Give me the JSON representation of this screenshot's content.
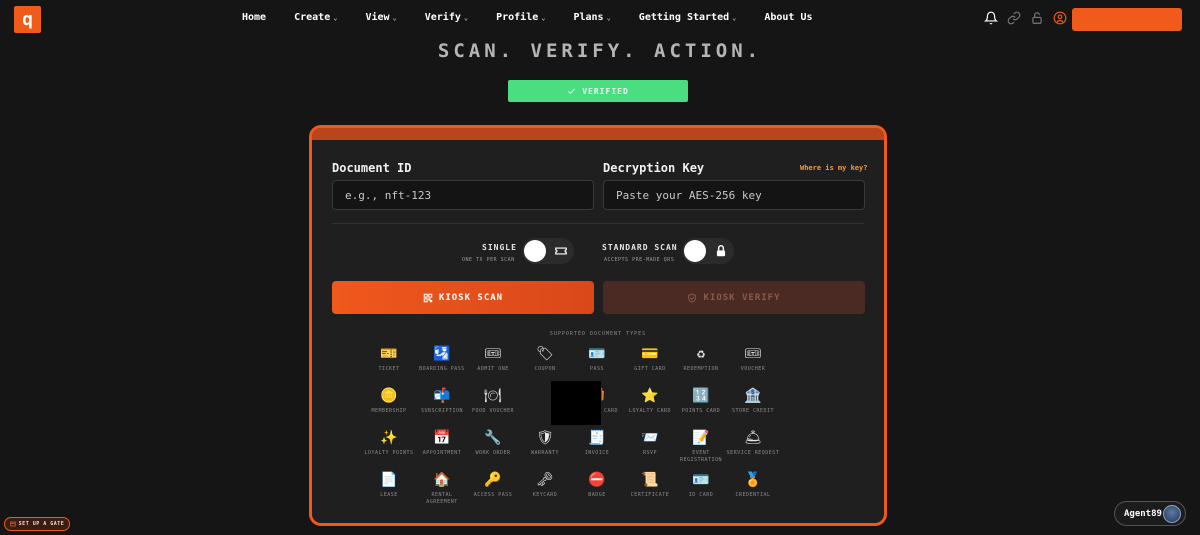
{
  "nav": {
    "logo_text": "q",
    "items": [
      {
        "label": "Home",
        "chevron": false
      },
      {
        "label": "Create",
        "chevron": true
      },
      {
        "label": "View",
        "chevron": true
      },
      {
        "label": "Verify",
        "chevron": true
      },
      {
        "label": "Profile",
        "chevron": true
      },
      {
        "label": "Plans",
        "chevron": true
      },
      {
        "label": "Getting Started",
        "chevron": true
      },
      {
        "label": "About Us",
        "chevron": false
      }
    ],
    "icons": [
      "bell-icon",
      "link-icon",
      "unlock-icon",
      "user-circle-icon"
    ]
  },
  "hero": {
    "tagline": "SCAN. VERIFY. ACTION."
  },
  "status": {
    "label": "VERIFIED",
    "color": "#4ade80"
  },
  "form": {
    "document_id_label": "Document ID",
    "document_id_placeholder": "e.g., nft-123",
    "key_label": "Decryption Key",
    "key_placeholder": "Paste your AES-256 key",
    "key_help_link": "Where is my key?"
  },
  "toggles": [
    {
      "label": "SINGLE",
      "sub": "ONE TX PER SCAN",
      "icon": "ticket-icon"
    },
    {
      "label": "STANDARD SCAN",
      "sub": "ACCEPTS PRE-MADE QRS",
      "icon": "lock-icon"
    }
  ],
  "actions": {
    "scan_label": "KIOSK SCAN",
    "verify_label": "KIOSK VERIFY"
  },
  "types": {
    "title": "SUPPORTED DOCUMENT TYPES",
    "items": [
      {
        "label": "TICKET",
        "icon": "🎫"
      },
      {
        "label": "BOARDING PASS",
        "icon": "🛂"
      },
      {
        "label": "ADMIT ONE",
        "icon": "🎟"
      },
      {
        "label": "COUPON",
        "icon": "🏷"
      },
      {
        "label": "PASS",
        "icon": "🪪"
      },
      {
        "label": "GIFT CARD",
        "icon": "💳"
      },
      {
        "label": "REDEMPTION",
        "icon": "♻"
      },
      {
        "label": "VOUCHER",
        "icon": "🎟"
      },
      {
        "label": "MEMBERSHIP",
        "icon": "🪙"
      },
      {
        "label": "SUBSCRIPTION",
        "icon": "📬"
      },
      {
        "label": "FOOD VOUCHER",
        "icon": "🍽"
      },
      {
        "label": "",
        "icon": ""
      },
      {
        "label": "REWARDS CARD",
        "icon": "🎁"
      },
      {
        "label": "LOYALTY CARD",
        "icon": "⭐"
      },
      {
        "label": "POINTS CARD",
        "icon": "🔢"
      },
      {
        "label": "STORE CREDIT",
        "icon": "🏦"
      },
      {
        "label": "LOYALTY POINTS",
        "icon": "✨"
      },
      {
        "label": "APPOINTMENT",
        "icon": "📅"
      },
      {
        "label": "WORK ORDER",
        "icon": "🔧"
      },
      {
        "label": "WARRANTY",
        "icon": "🛡"
      },
      {
        "label": "INVOICE",
        "icon": "🧾"
      },
      {
        "label": "RSVP",
        "icon": "📨"
      },
      {
        "label": "EVENT REGISTRATION",
        "icon": "📝"
      },
      {
        "label": "SERVICE REQUEST",
        "icon": "🛎"
      },
      {
        "label": "LEASE",
        "icon": "📄"
      },
      {
        "label": "RENTAL AGREEMENT",
        "icon": "🏠"
      },
      {
        "label": "ACCESS PASS",
        "icon": "🔑"
      },
      {
        "label": "KEYCARD",
        "icon": "🗝"
      },
      {
        "label": "BADGE",
        "icon": "⛔"
      },
      {
        "label": "CERTIFICATE",
        "icon": "📜"
      },
      {
        "label": "ID CARD",
        "icon": "🪪"
      },
      {
        "label": "CREDENTIAL",
        "icon": "🏅"
      }
    ]
  },
  "footer": {
    "gate_label": "SET UP A GATE",
    "agent_name": "Agent89"
  },
  "colors": {
    "accent": "#f05a1a",
    "background": "#151515",
    "card": "#1f1f1f"
  }
}
